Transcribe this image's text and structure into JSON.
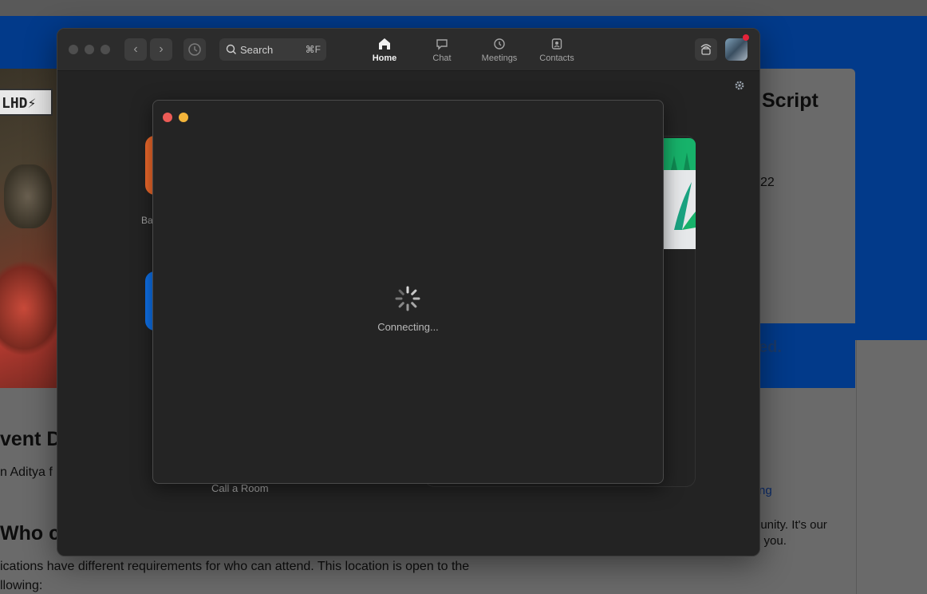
{
  "background_page": {
    "logo_badge": "LHD",
    "right_heading": "Script",
    "right_number": "22",
    "callout_text": "ed.",
    "heading_event": "vent D",
    "text_aditya": "n Aditya f",
    "heading_who": "Who ca",
    "text_locations_line1": "ications have different requirements for who can attend. This location is open to the",
    "text_locations_line2": "llowing:",
    "link_partial": "ng",
    "text_community_line1": "nunity. It's our",
    "text_community_line2": "e you."
  },
  "zoom": {
    "search": {
      "label": "Search",
      "shortcut": "⌘F"
    },
    "tabs": [
      {
        "label": "Home",
        "icon": "home-icon",
        "active": true
      },
      {
        "label": "Chat",
        "icon": "chat-icon",
        "active": false
      },
      {
        "label": "Meetings",
        "icon": "clock-icon",
        "active": false
      },
      {
        "label": "Contacts",
        "icon": "contacts-icon",
        "active": false
      }
    ],
    "home": {
      "tile_partial_label": "Ba",
      "call_room_label": "Call a Room"
    }
  },
  "dialog": {
    "status_text": "Connecting..."
  },
  "colors": {
    "accent_blue": "#0e72ed",
    "accent_orange": "#f36b2c",
    "close_red": "#ec5b56",
    "minimize_yellow": "#f3b43a",
    "page_blue": "#023a8a"
  }
}
